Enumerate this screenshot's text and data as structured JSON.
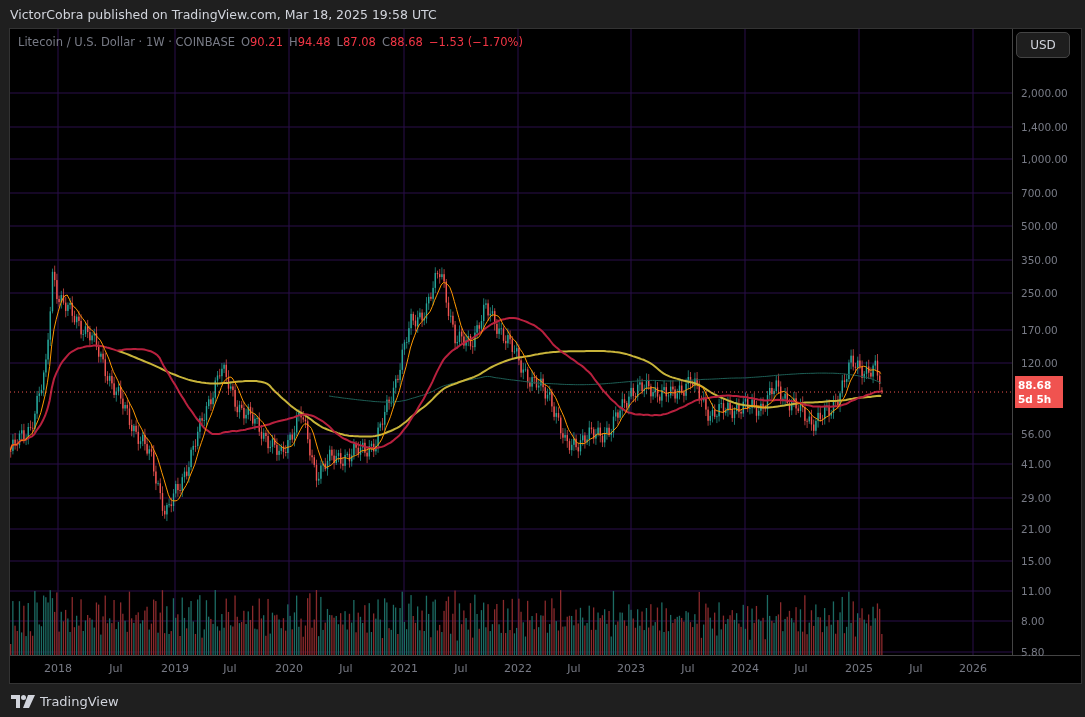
{
  "header": {
    "text": "VictorCobra published on TradingView.com, Mar 18, 2025 19:58 UTC"
  },
  "legend": {
    "symbol": "Litecoin / U.S. Dollar · 1W · COINBASE",
    "ohlc": [
      {
        "label": "O",
        "value": "90.21"
      },
      {
        "label": "H",
        "value": "94.48"
      },
      {
        "label": "L",
        "value": "87.08"
      },
      {
        "label": "C",
        "value": "88.68"
      }
    ],
    "change": "−1.53 (−1.70%)"
  },
  "currency_button": "USD",
  "price_axis": [
    "2,000.00",
    "1,400.00",
    "1,000.00",
    "700.00",
    "500.00",
    "350.00",
    "250.00",
    "170.00",
    "120.00",
    "56.00",
    "41.00",
    "29.00",
    "21.00",
    "15.00",
    "11.00",
    "8.00",
    "5.80"
  ],
  "last_price": {
    "value": "88.68",
    "countdown": "5d 5h"
  },
  "time_axis": [
    "2018",
    "Jul",
    "2019",
    "Jul",
    "2020",
    "Jul",
    "2021",
    "Jul",
    "2022",
    "Jul",
    "2023",
    "Jul",
    "2024",
    "Jul",
    "2025",
    "Jul",
    "2026"
  ],
  "footer": {
    "brand": "TradingView"
  }
}
